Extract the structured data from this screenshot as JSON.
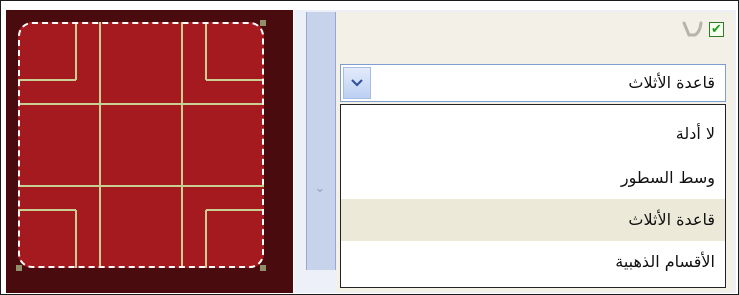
{
  "canvas": {
    "background_color": "#4a0b0f",
    "square_color": "#a51a1f",
    "guide_color": "#c9cf92",
    "selection_color": "#ffffff"
  },
  "panel": {
    "icons": {
      "enable_checkbox": "checkbox-checked",
      "checkbox_mark": "✔",
      "tool_icon": "hook-icon"
    },
    "combo": {
      "selected_value": "قاعدة الأثلاث",
      "dropdown_icon": "chevron-down-icon"
    },
    "options": [
      {
        "label": "لا أدلة",
        "selected": false
      },
      {
        "label": "وسط السطور",
        "selected": false
      },
      {
        "label": "قاعدة الأثلاث",
        "selected": true
      },
      {
        "label": "الأقسام الذهبية",
        "selected": false
      }
    ],
    "scroll_arrow": "⌄"
  }
}
